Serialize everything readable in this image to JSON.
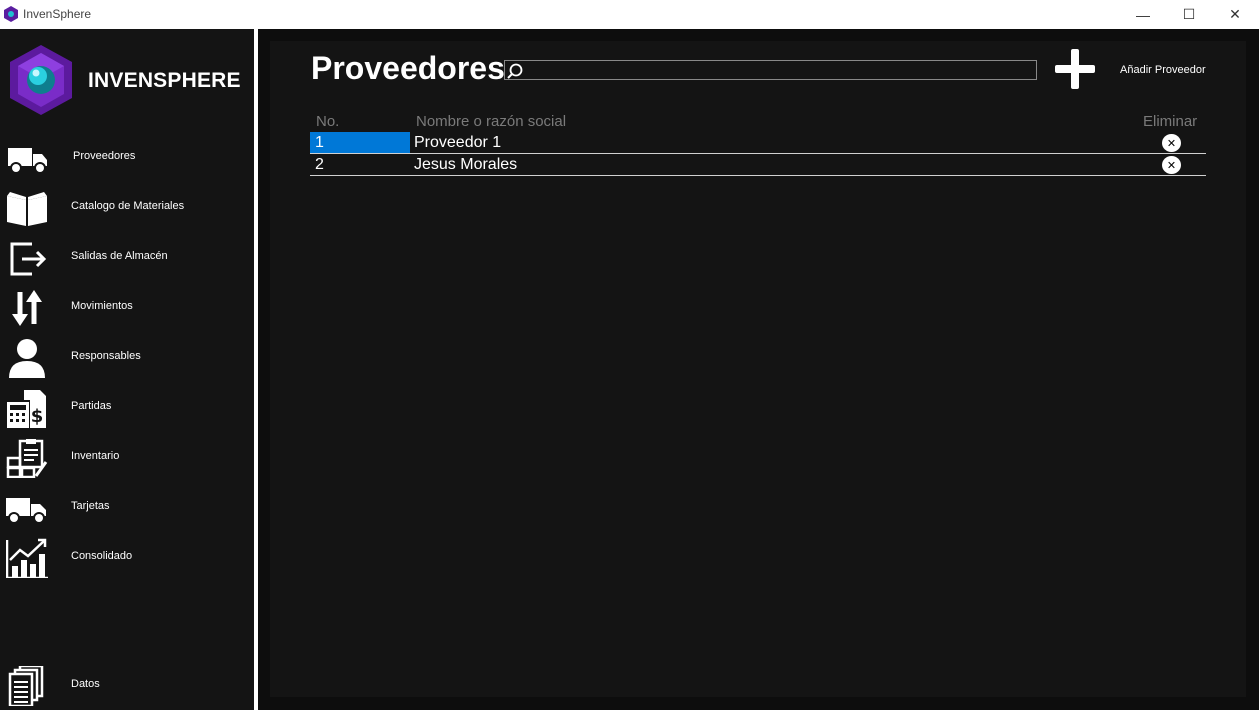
{
  "window": {
    "title": "InvenSphere",
    "minimize_glyph": "—",
    "maximize_glyph": "☐",
    "close_glyph": "✕"
  },
  "brand": {
    "name": "INVENSPHERE"
  },
  "sidebar": {
    "items": [
      {
        "label": "Proveedores",
        "icon": "truck-icon"
      },
      {
        "label": "Catalogo de Materiales",
        "icon": "open-book-icon"
      },
      {
        "label": "Salidas de Almacén",
        "icon": "exit-arrow-icon"
      },
      {
        "label": "Movimientos",
        "icon": "up-down-arrows-icon"
      },
      {
        "label": "Responsables",
        "icon": "person-icon"
      },
      {
        "label": "Partidas",
        "icon": "calculator-money-icon"
      },
      {
        "label": "Inventario",
        "icon": "clipboard-boxes-icon"
      },
      {
        "label": "Tarjetas",
        "icon": "truck-icon"
      },
      {
        "label": "Consolidado",
        "icon": "growth-chart-icon"
      },
      {
        "label": "Datos",
        "icon": "documents-icon"
      }
    ]
  },
  "main": {
    "title": "Proveedores",
    "search": {
      "value": "",
      "placeholder": ""
    },
    "add_label": "Añadir Proveedor",
    "table": {
      "headers": {
        "no": "No.",
        "name": "Nombre o razón social",
        "delete": "Eliminar"
      },
      "rows": [
        {
          "no": "1",
          "name": "Proveedor 1",
          "delete_glyph": "✕",
          "selected": true
        },
        {
          "no": "2",
          "name": "Jesus Morales",
          "delete_glyph": "✕",
          "selected": false
        }
      ]
    }
  },
  "colors": {
    "selection": "#0078d7",
    "background": "#141414",
    "logo": "#6a1fb0"
  }
}
